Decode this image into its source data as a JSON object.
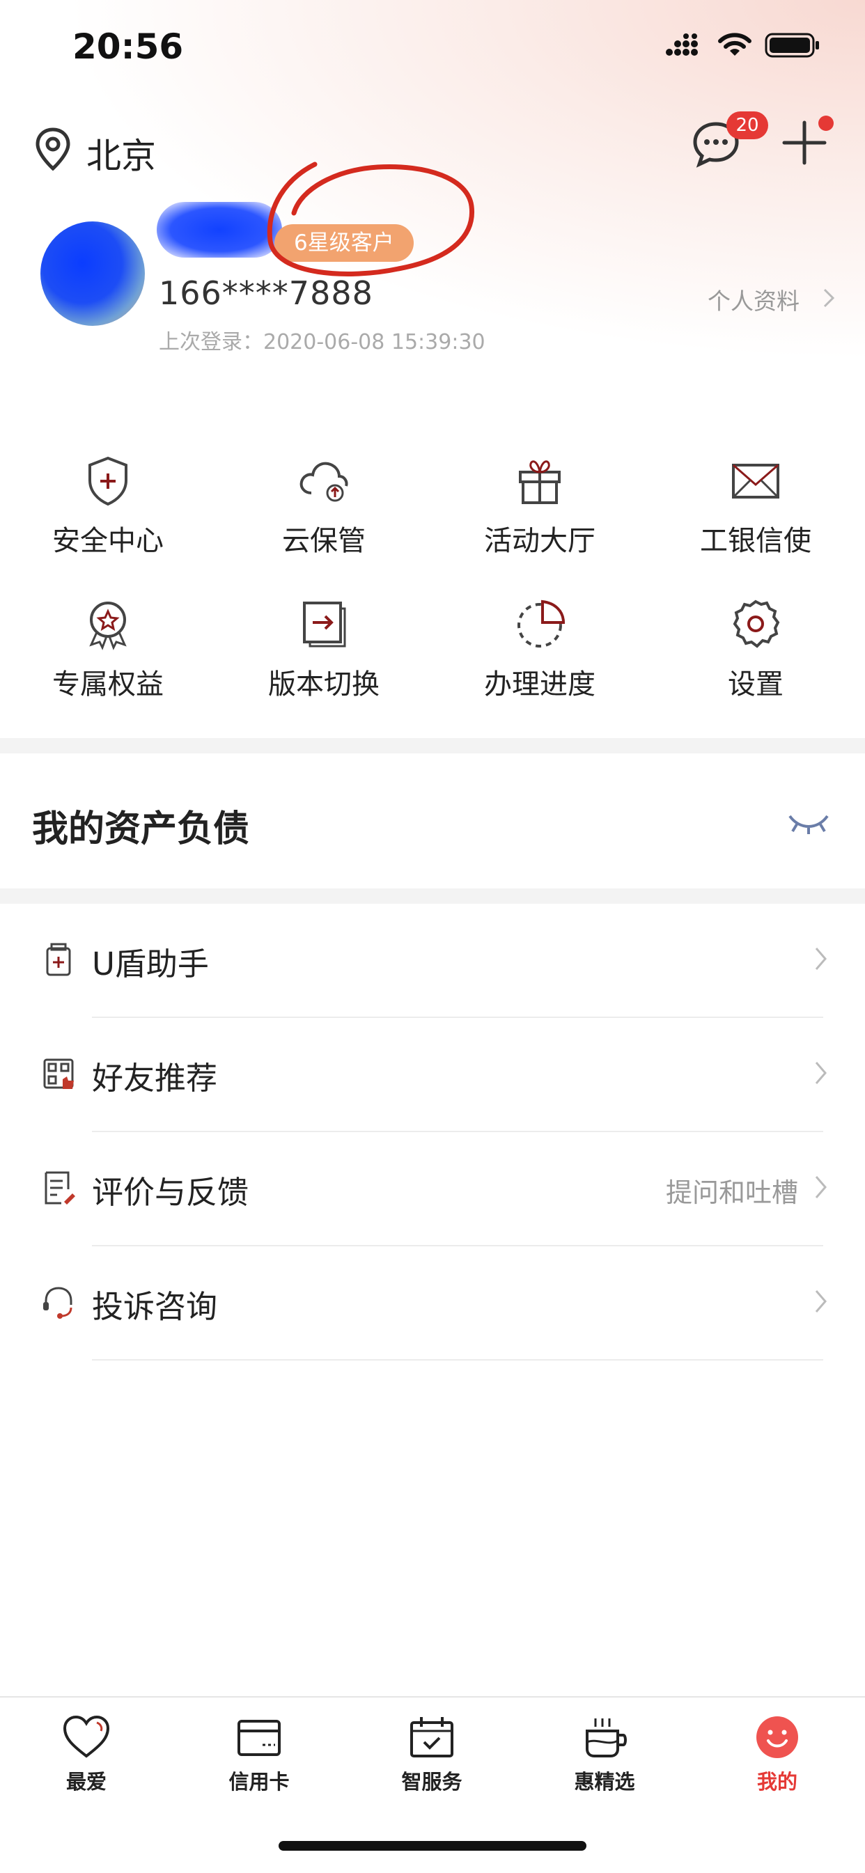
{
  "status_bar": {
    "time": "20:56"
  },
  "header": {
    "location": "北京",
    "message_badge": "20",
    "accent_color": "#e53935"
  },
  "profile": {
    "customer_level": "6星级客户",
    "phone": "166****7888",
    "last_login": "上次登录：2020-06-08 15:39:30",
    "profile_link": "个人资料"
  },
  "quick_actions": [
    {
      "label": "安全中心",
      "icon": "shield-plus-icon"
    },
    {
      "label": "云保管",
      "icon": "cloud-upload-icon"
    },
    {
      "label": "活动大厅",
      "icon": "gift-icon"
    },
    {
      "label": "工银信使",
      "icon": "envelope-icon"
    },
    {
      "label": "专属权益",
      "icon": "medal-icon"
    },
    {
      "label": "版本切换",
      "icon": "switch-icon"
    },
    {
      "label": "办理进度",
      "icon": "progress-pie-icon"
    },
    {
      "label": "设置",
      "icon": "gear-icon"
    }
  ],
  "assets": {
    "title": "我的资产负债",
    "visibility_icon": "eye-closed-icon"
  },
  "menu_list": [
    {
      "label": "U盾助手",
      "sub": "",
      "icon": "ushield-icon"
    },
    {
      "label": "好友推荐",
      "sub": "",
      "icon": "qrcode-icon"
    },
    {
      "label": "评价与反馈",
      "sub": "提问和吐槽",
      "icon": "feedback-icon"
    },
    {
      "label": "投诉咨询",
      "sub": "",
      "icon": "headset-icon"
    }
  ],
  "tabbar": [
    {
      "label": "最爱",
      "icon": "heart-icon",
      "active": false
    },
    {
      "label": "信用卡",
      "icon": "credit-card-icon",
      "active": false
    },
    {
      "label": "智服务",
      "icon": "calendar-check-icon",
      "active": false
    },
    {
      "label": "惠精选",
      "icon": "cup-icon",
      "active": false
    },
    {
      "label": "我的",
      "icon": "smile-icon",
      "active": true
    }
  ]
}
